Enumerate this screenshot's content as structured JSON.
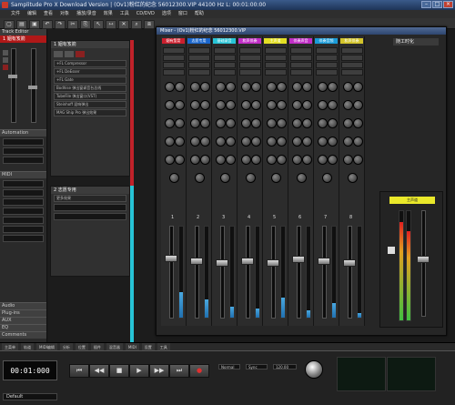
{
  "window": {
    "title": "Samplitude Pro X Download Version  |  (Ov1)粉红的纪念 56012300.VIP  44100 Hz  L: 00:01:00:00",
    "menu": [
      "文件",
      "编辑",
      "查看",
      "对象",
      "播放/录音",
      "效果",
      "工具",
      "CD/DVD",
      "选项",
      "窗口",
      "帮助"
    ]
  },
  "track_editor": {
    "header": "Track Editor",
    "track_name": "1 姻有笈箭",
    "section_automation": "Automation",
    "section_midi": "MIDI",
    "footer": [
      "Audio",
      "Plug-ins",
      "AUX",
      "EQ",
      "Comments"
    ]
  },
  "tracks": [
    {
      "index": "1",
      "name": "姻有笈箭",
      "plugins": [
        "+FL Compressor",
        "+FL DeEsser",
        "+FL Gate",
        "Bodhise 弹出窗调音台总线",
        "TubeFile 弹出窗口(VST)",
        "Steinhoff 混响弹出",
        "MAG Ship Pro 弹出效果"
      ]
    },
    {
      "index": "2",
      "name": "志愿专用",
      "plugins": [
        "更多效果"
      ]
    }
  ],
  "mixer": {
    "title": "Mixer - (Ov1)粉红的纪念 56012300.VIP",
    "right_label": "随工时化",
    "channels": [
      {
        "num": "1",
        "label": "姻有笈箭",
        "color": "#cc1f2e",
        "meter": 0.28,
        "fader": 0.65
      },
      {
        "num": "2",
        "label": "志愿专用",
        "color": "#1a66cc",
        "meter": 0.2,
        "fader": 0.62
      },
      {
        "num": "3",
        "label": "基础录音",
        "color": "#27c4d6",
        "meter": 0.12,
        "fader": 0.6
      },
      {
        "num": "4",
        "label": "和声伴奏",
        "color": "#c12ec6",
        "meter": 0.1,
        "fader": 0.62
      },
      {
        "num": "5",
        "label": "主声道",
        "color": "#e3df24",
        "meter": 0.22,
        "fader": 0.6
      },
      {
        "num": "6",
        "label": "伴奏声音",
        "color": "#c12ec6",
        "meter": 0.08,
        "fader": 0.64
      },
      {
        "num": "7",
        "label": "伴奏音频",
        "color": "#1a9bd8",
        "meter": 0.16,
        "fader": 0.62
      },
      {
        "num": "8",
        "label": "和声伴奏",
        "color": "#d3c42a",
        "meter": 0.05,
        "fader": 0.6
      }
    ],
    "master": {
      "label": "主声道",
      "meter_l": 0.9,
      "meter_r": 0.82
    }
  },
  "transport": {
    "timecode": "00:01:000",
    "mode": "Normal",
    "sync": "Sync",
    "bpm": "120.00",
    "preset": "Default",
    "tabs": [
      "主菜单",
      "轨道",
      "MIDI编辑",
      "分析",
      "位置",
      "插件",
      "混音器",
      "MIDI",
      "设置",
      "工具"
    ]
  }
}
